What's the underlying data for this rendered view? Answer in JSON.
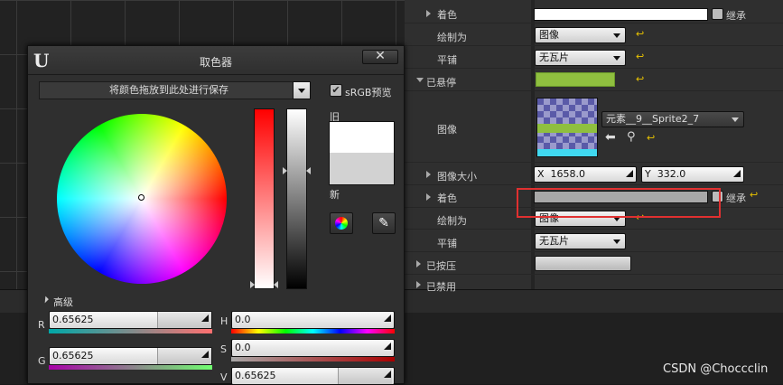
{
  "picker": {
    "title": "取色器",
    "close_label": "✕",
    "save_dropdown": "将颜色拖放到此处进行保存",
    "srgb_label": "sRGB预览",
    "old_label": "旧",
    "new_label": "新",
    "advanced_label": "高级",
    "fields": {
      "r_label": "R",
      "r_value": "0.65625",
      "g_label": "G",
      "g_value": "0.65625",
      "h_label": "H",
      "h_value": "0.0",
      "s_label": "S",
      "s_value": "0.0",
      "v_label": "V",
      "v_value": "0.65625"
    }
  },
  "details": {
    "tint_label_top": "着色",
    "inherit_label": "继承",
    "draw_as_label": "绘制为",
    "draw_as_value": "图像",
    "tiling_label": "平铺",
    "tiling_value": "无瓦片",
    "hovered_label": "已悬停",
    "image_label": "图像",
    "image_asset": "元素__9__Sprite2_7",
    "image_size_label": "图像大小",
    "size_x_label": "X",
    "size_x_value": "1658.0",
    "size_y_label": "Y",
    "size_y_value": "332.0",
    "tint_label": "着色",
    "draw_as_label2": "绘制为",
    "draw_as_value2": "图像",
    "tiling_label2": "平铺",
    "tiling_value2": "无瓦片",
    "pressed_label": "已按压",
    "disabled_label": "已禁用"
  },
  "watermark": "CSDN @Choccclin",
  "colors": {
    "highlight_box": "#e03030",
    "reset_arrow": "#e8c200",
    "hover_tint": "#8fbf3f"
  }
}
